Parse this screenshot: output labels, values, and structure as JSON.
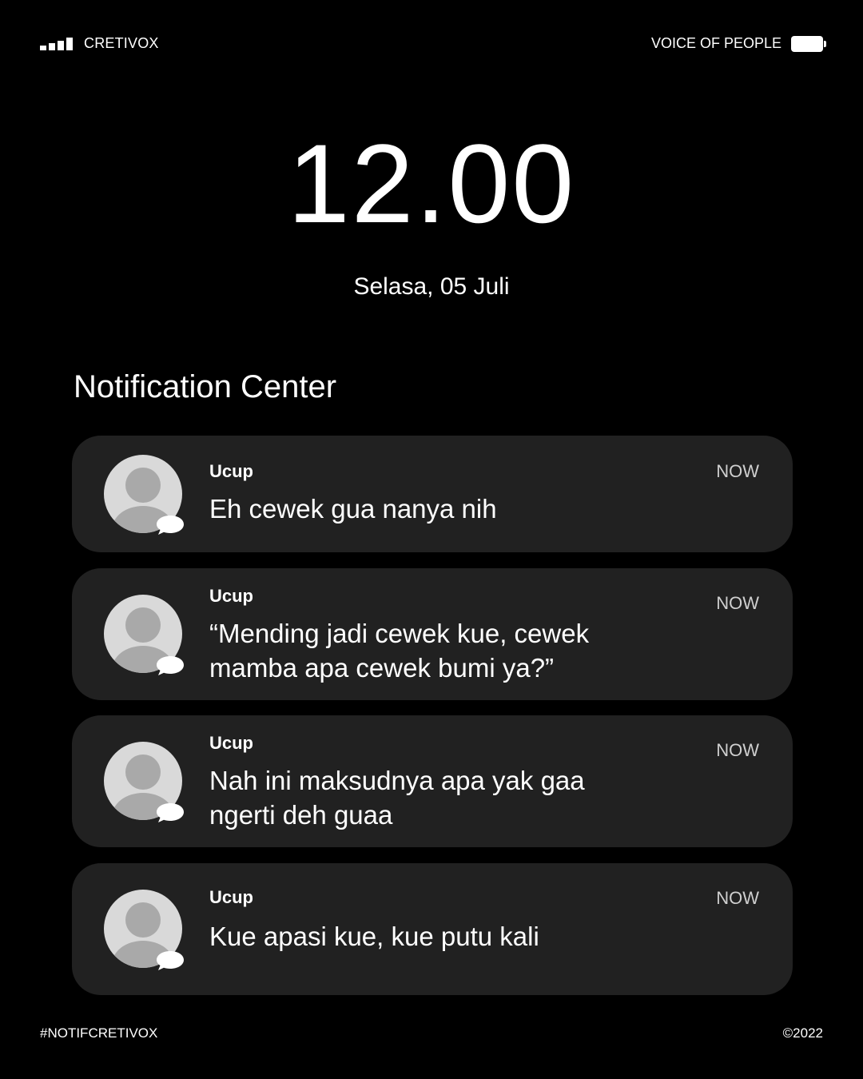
{
  "status_bar": {
    "carrier": "CRETIVOX",
    "right_label": "VOICE OF PEOPLE",
    "signal_icon": "signal-bars-icon",
    "battery_icon": "battery-icon"
  },
  "lock_screen": {
    "time": "12.00",
    "date": "Selasa, 05 Juli"
  },
  "notification_center": {
    "title": "Notification Center",
    "notifications": [
      {
        "sender": "Ucup",
        "time": "NOW",
        "message": "Eh cewek gua nanya nih",
        "avatar_icon": "user-avatar-icon",
        "badge_icon": "chat-bubble-icon"
      },
      {
        "sender": "Ucup",
        "time": "NOW",
        "message": "“Mending jadi cewek kue, cewek mamba apa cewek bumi ya?”",
        "avatar_icon": "user-avatar-icon",
        "badge_icon": "chat-bubble-icon"
      },
      {
        "sender": "Ucup",
        "time": "NOW",
        "message": "Nah ini maksudnya apa yak gaa ngerti deh guaa",
        "avatar_icon": "user-avatar-icon",
        "badge_icon": "chat-bubble-icon"
      },
      {
        "sender": "Ucup",
        "time": "NOW",
        "message": "Kue apasi kue, kue putu kali",
        "avatar_icon": "user-avatar-icon",
        "badge_icon": "chat-bubble-icon"
      }
    ]
  },
  "footer": {
    "hashtag": "#NOTIFCRETIVOX",
    "copyright": "©2022"
  },
  "colors": {
    "background": "#000000",
    "card": "#212121",
    "text": "#ffffff",
    "avatar_bg": "#d9d9d9",
    "avatar_fg": "#a9a9a9"
  }
}
